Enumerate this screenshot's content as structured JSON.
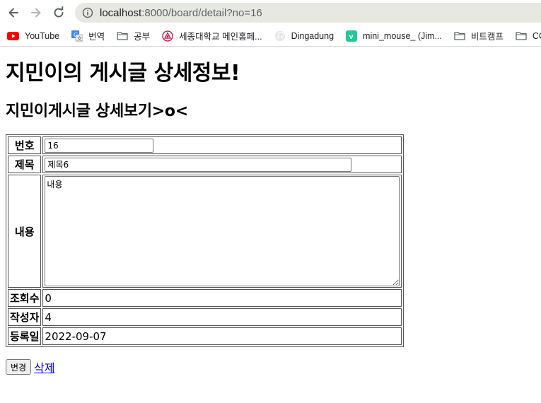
{
  "browser": {
    "url_host": "localhost",
    "url_path": ":8000/board/detail?no=16",
    "bookmarks": [
      {
        "label": "YouTube",
        "icon": "youtube-icon"
      },
      {
        "label": "번역",
        "icon": "translate-icon"
      },
      {
        "label": "공부",
        "icon": "folder-icon"
      },
      {
        "label": "세종대학교 메인홈페...",
        "icon": "university-icon"
      },
      {
        "label": "Dingadung",
        "icon": "github-icon"
      },
      {
        "label": "mini_mouse_ (Jim...",
        "icon": "velog-icon"
      },
      {
        "label": "비트캠프",
        "icon": "folder-icon"
      },
      {
        "label": "CODIN",
        "icon": "folder-icon"
      }
    ]
  },
  "page": {
    "heading": "지민이의 게시글 상세정보!",
    "subheading": "지민이게시글 상세보기>o<"
  },
  "detail": {
    "labels": {
      "no": "번호",
      "title": "제목",
      "content": "내용",
      "views": "조회수",
      "writer": "작성자",
      "date": "등록일"
    },
    "values": {
      "no": "16",
      "title": "제목6",
      "content": "내용",
      "views": "0",
      "writer": "4",
      "date": "2022-09-07"
    }
  },
  "actions": {
    "update_label": "변경",
    "delete_label": "삭제"
  },
  "colors": {
    "link": "#0000ee",
    "omnibox_bg": "#e8e8e3",
    "youtube_red": "#ff0000",
    "velog_green": "#20c997"
  }
}
